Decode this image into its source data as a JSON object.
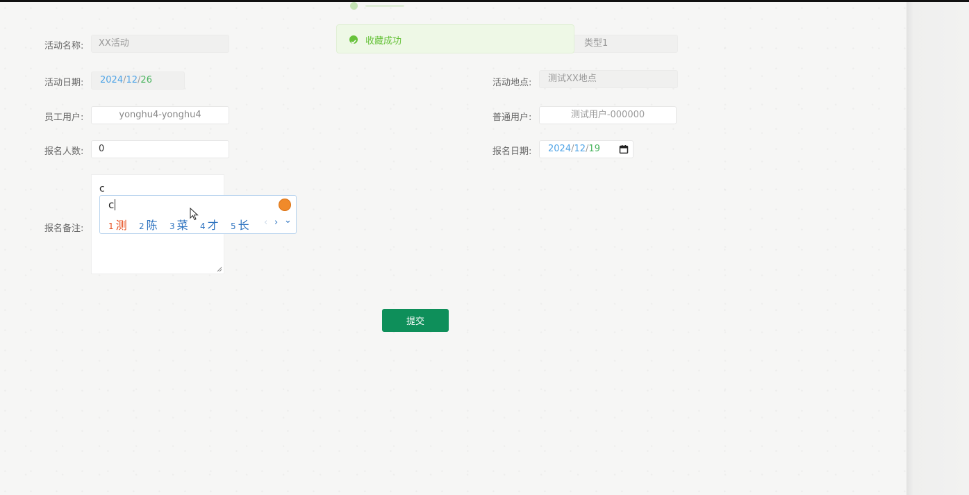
{
  "toast": {
    "message": "收藏成功",
    "type": "success"
  },
  "form": {
    "activity_name": {
      "label": "活动名称:",
      "value": "XX活动"
    },
    "activity_type": {
      "value_partial": "类型1"
    },
    "activity_date": {
      "label": "活动日期:",
      "year": "2024",
      "month": "12",
      "day": "26",
      "sep": "/"
    },
    "activity_location": {
      "label": "活动地点:",
      "value": "测试XX地点"
    },
    "staff_user": {
      "label": "员工用户:",
      "value": "yonghu4-yonghu4"
    },
    "normal_user": {
      "label": "普通用户:",
      "value": "测试用户-000000"
    },
    "signup_count": {
      "label": "报名人数:",
      "value": "0"
    },
    "signup_date": {
      "label": "报名日期:",
      "year": "2024",
      "month": "12",
      "day": "19",
      "sep": "/"
    },
    "signup_note": {
      "label": "报名备注:",
      "value": "c"
    }
  },
  "ime": {
    "composition": "c",
    "candidates": [
      {
        "num": "1",
        "text": "测"
      },
      {
        "num": "2",
        "text": "陈"
      },
      {
        "num": "3",
        "text": "菜"
      },
      {
        "num": "4",
        "text": "才"
      },
      {
        "num": "5",
        "text": "长"
      }
    ],
    "prev": "‹",
    "next": "›",
    "expand": "⌄"
  },
  "submit_label": "提交",
  "colors": {
    "primary": "#0e8f5a",
    "success": "#67c23a",
    "date_blue": "#4da3e6",
    "date_green": "#47b35c"
  }
}
